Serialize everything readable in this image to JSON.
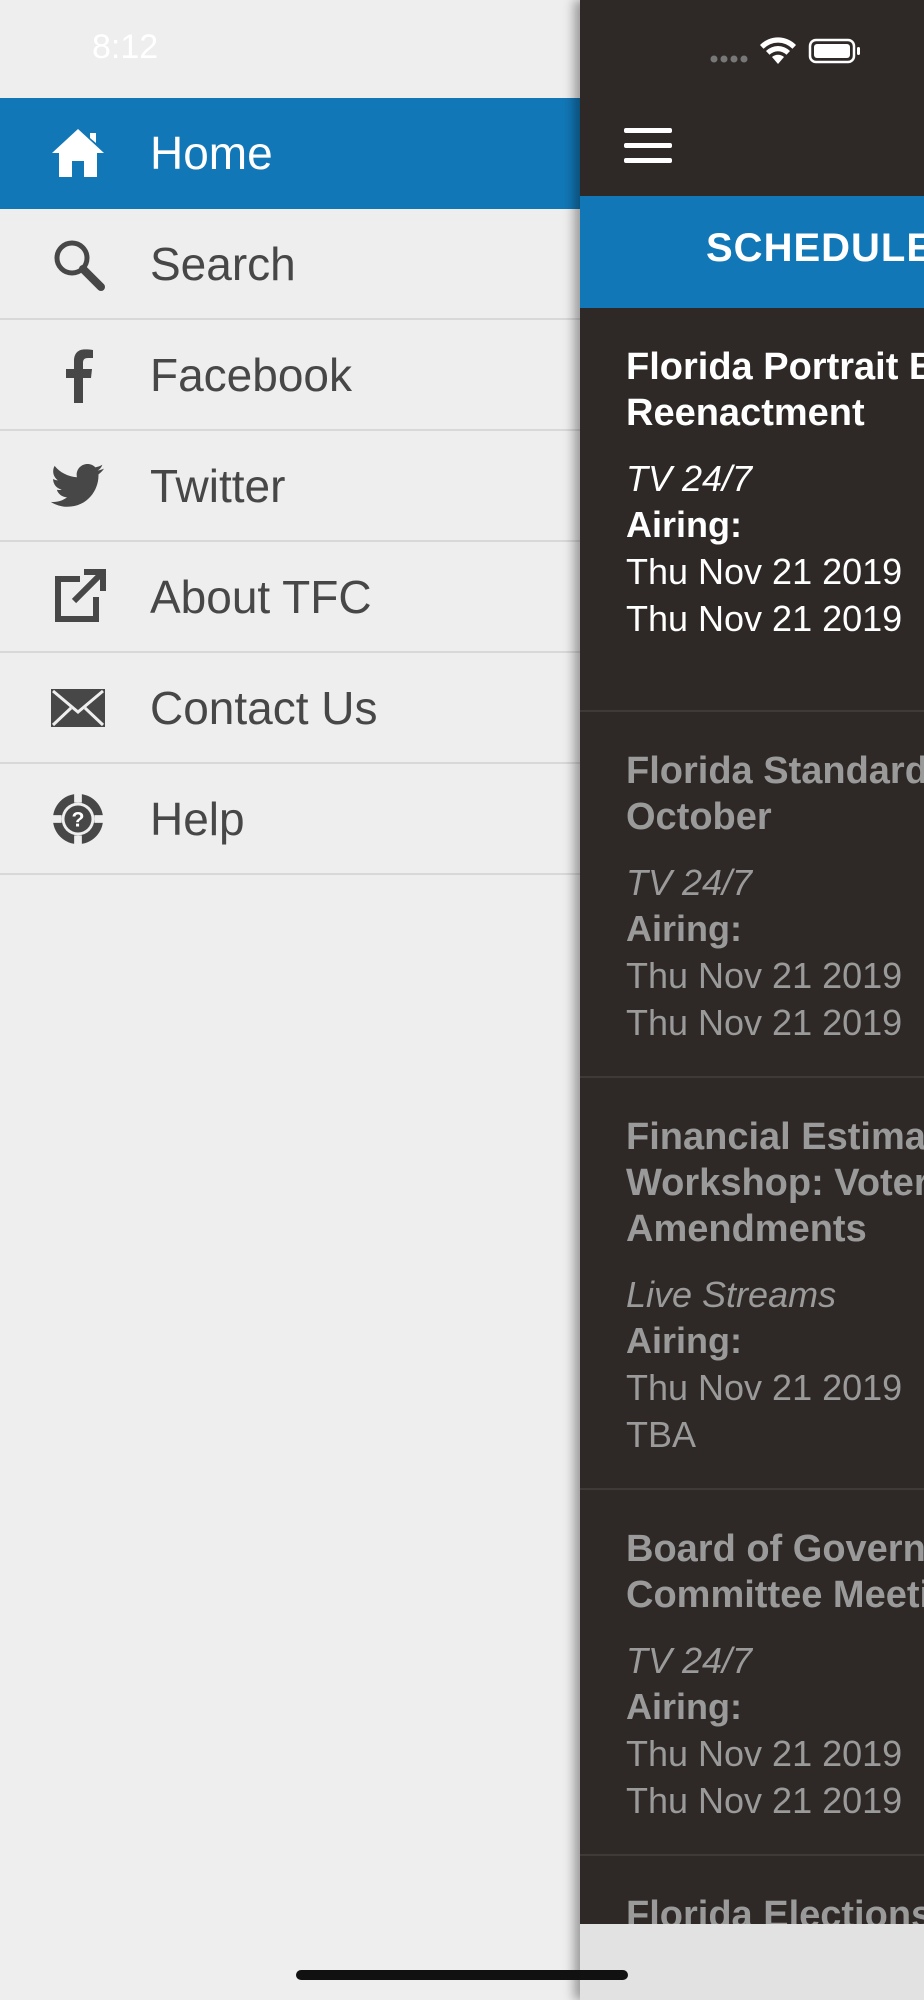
{
  "status": {
    "time": "8:12"
  },
  "menu": {
    "items": [
      {
        "label": "Home",
        "icon": "home-icon",
        "active": true
      },
      {
        "label": "Search",
        "icon": "search-icon"
      },
      {
        "label": "Facebook",
        "icon": "facebook-icon"
      },
      {
        "label": "Twitter",
        "icon": "twitter-icon"
      },
      {
        "label": "About TFC",
        "icon": "external-link-icon"
      },
      {
        "label": "Contact Us",
        "icon": "envelope-icon"
      },
      {
        "label": "Help",
        "icon": "help-lifebuoy-icon"
      }
    ]
  },
  "panel": {
    "header_title": "SCHEDULE",
    "entries": [
      {
        "title": "Florida Portrait Bridge Reenactment",
        "category": "TV 24/7",
        "airing_label": "Airing:",
        "line1": "Thu Nov 21 2019",
        "line2": "Thu Nov 21 2019"
      },
      {
        "title": "Florida Standard Naples, October",
        "category": "TV 24/7",
        "airing_label": "Airing:",
        "line1": "Thu Nov 21 2019",
        "line2": "Thu Nov 21 2019"
      },
      {
        "title": "Financial Estimating Workshop: Voter Amendments",
        "category": "Live Streams",
        "airing_label": "Airing:",
        "line1": "Thu Nov 21 2019",
        "line2": "TBA"
      },
      {
        "title": "Board of Governors Committee Meeting",
        "category": "TV 24/7",
        "airing_label": "Airing:",
        "line1": "Thu Nov 21 2019",
        "line2": "Thu Nov 21 2019"
      },
      {
        "title": "Florida Elections"
      }
    ]
  },
  "colors": {
    "accent": "#1277b6",
    "panel_bg": "#2e2927",
    "menu_bg": "#eeeeee"
  }
}
